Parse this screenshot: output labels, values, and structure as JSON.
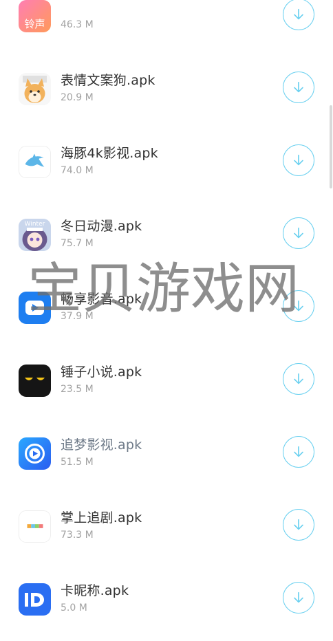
{
  "apps": [
    {
      "name": "",
      "size": "46.3 M",
      "icon": "ringtone-app-icon",
      "icon_text": "铃声"
    },
    {
      "name": "表情文案狗.apk",
      "size": "20.9 M",
      "icon": "shiba-dog-icon"
    },
    {
      "name": "海豚4k影视.apk",
      "size": "74.0 M",
      "icon": "dolphin-icon"
    },
    {
      "name": "冬日动漫.apk",
      "size": "75.7 M",
      "icon": "anime-girl-icon",
      "icon_text": "Winter"
    },
    {
      "name": "畅享影音.apk",
      "size": "37.9 M",
      "icon": "play-media-icon"
    },
    {
      "name": "锤子小说.apk",
      "size": "23.5 M",
      "icon": "eyes-icon"
    },
    {
      "name": "追梦影视.apk",
      "size": "51.5 M",
      "icon": "play-circle-icon"
    },
    {
      "name": "掌上追剧.apk",
      "size": "73.3 M",
      "icon": "tv-logo-icon"
    },
    {
      "name": "卡昵称.apk",
      "size": "5.0 M",
      "icon": "id-card-icon"
    }
  ],
  "download_icon": "download-arrow-icon",
  "watermark": "宝贝游戏网",
  "colors": {
    "accent": "#69d0f0",
    "title": "#333333",
    "size": "#a2a2a2"
  }
}
